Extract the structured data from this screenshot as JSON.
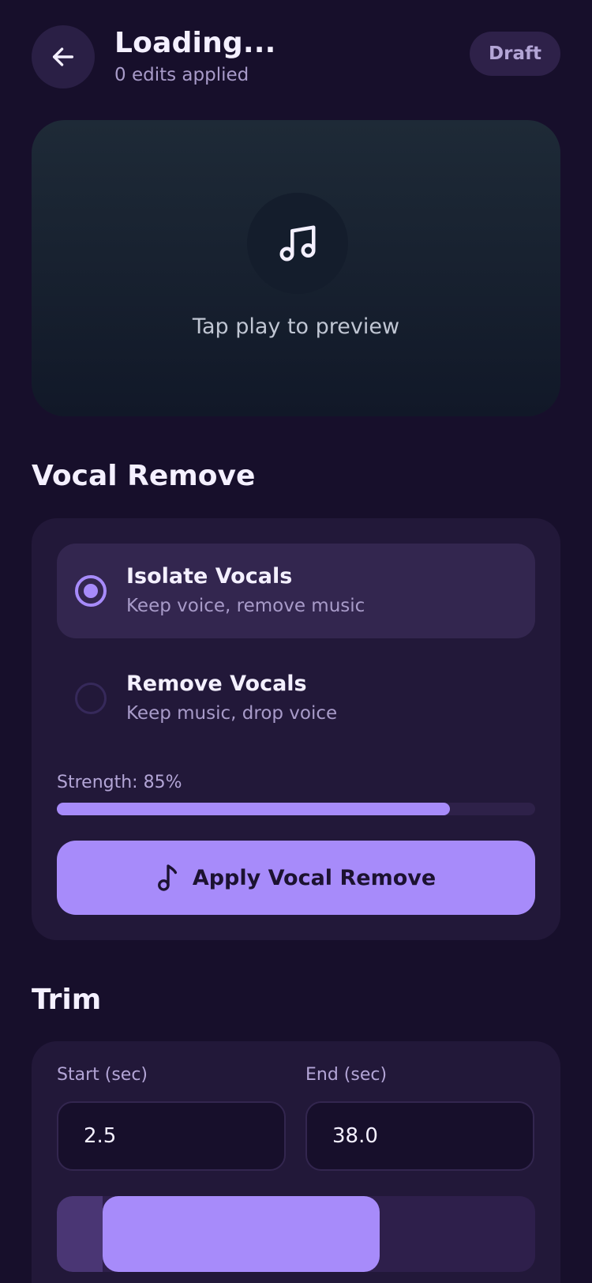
{
  "header": {
    "title": "Loading...",
    "subtitle": "0 edits applied",
    "badge": "Draft"
  },
  "preview": {
    "icon": "music-note-icon",
    "hint": "Tap play to preview"
  },
  "vocal_remove": {
    "section_title": "Vocal Remove",
    "options": [
      {
        "title": "Isolate Vocals",
        "subtitle": "Keep voice, remove music",
        "selected": true
      },
      {
        "title": "Remove Vocals",
        "subtitle": "Keep music, drop voice",
        "selected": false
      }
    ],
    "strength_label": "Strength: 85%",
    "strength_value": 0.85,
    "apply_label": "Apply Vocal Remove"
  },
  "trim": {
    "section_title": "Trim",
    "start_label": "Start (sec)",
    "start_value": "2.5",
    "end_label": "End (sec)",
    "end_value": "38.0",
    "dim_fraction": 0.095,
    "selection_start": 0.095,
    "selection_end": 0.675
  },
  "colors": {
    "background": "#170f2b",
    "accent": "#a78bfa",
    "card": "#221839"
  }
}
